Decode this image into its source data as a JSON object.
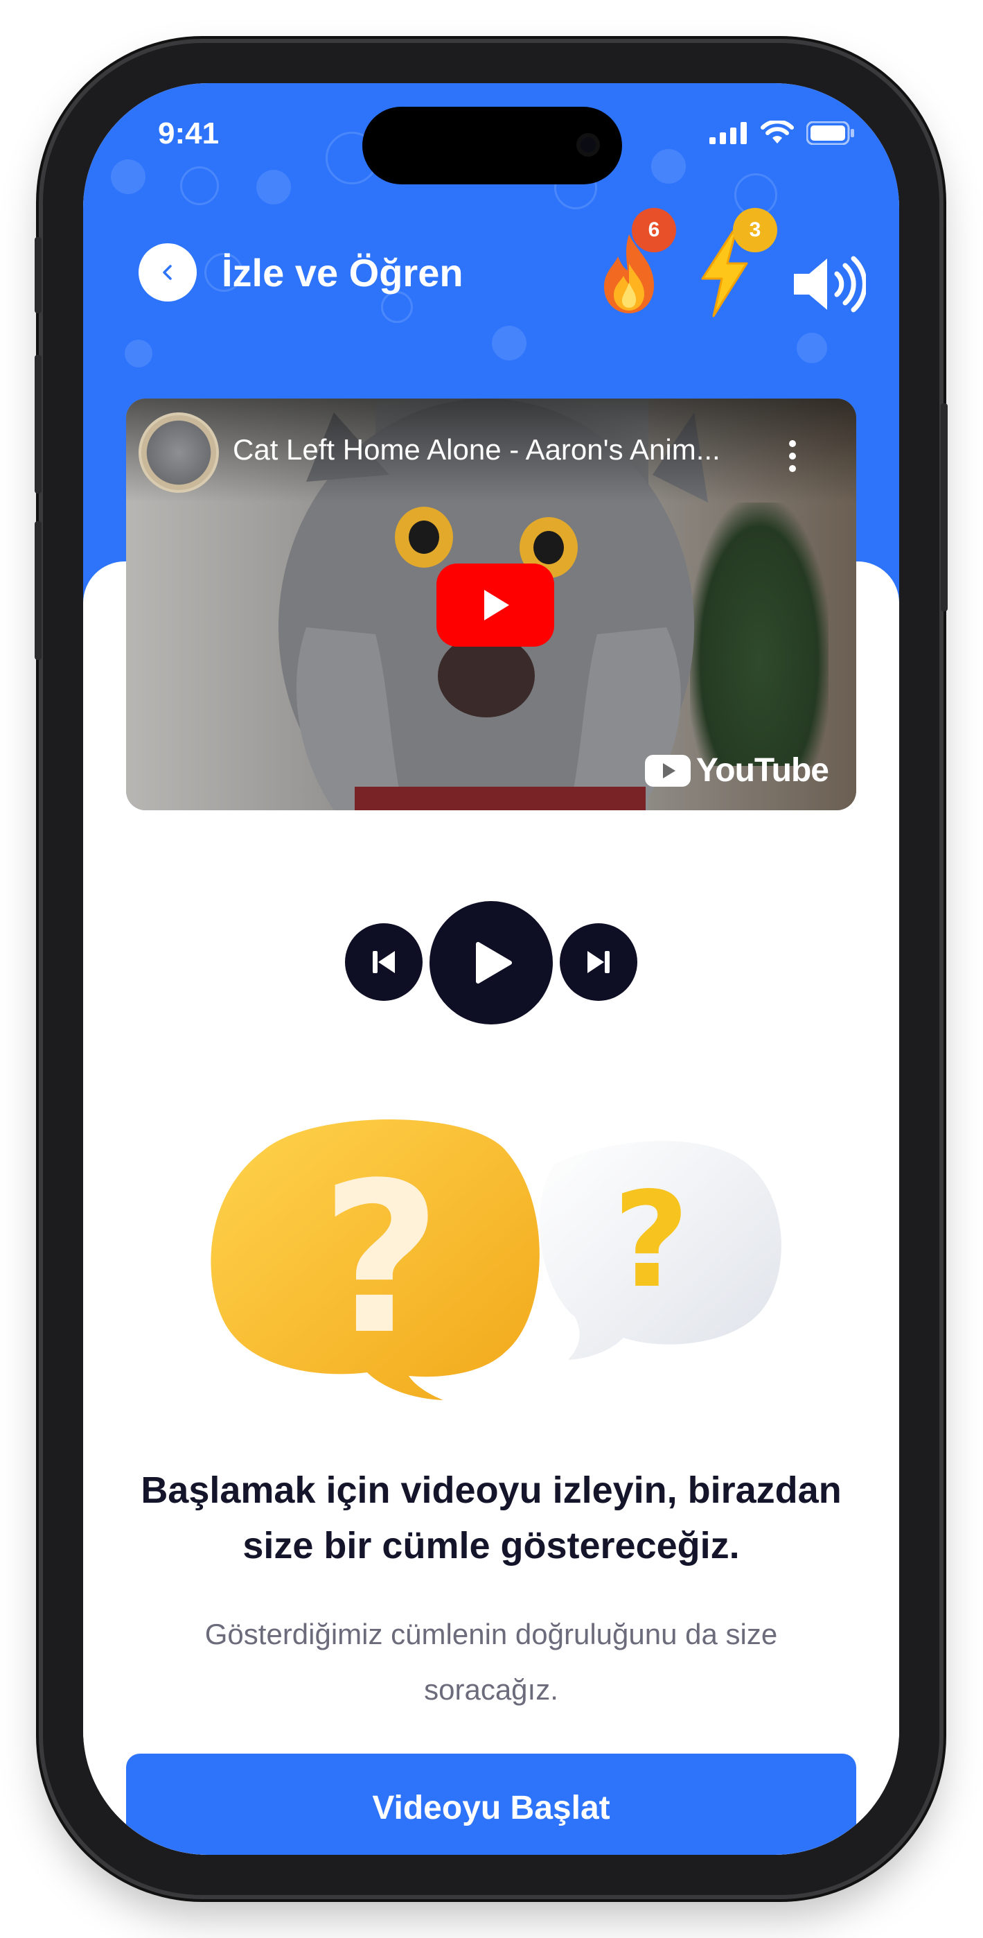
{
  "status_bar": {
    "time": "9:41"
  },
  "header": {
    "title": "İzle ve Öğren",
    "streak_count": "6",
    "energy_count": "3"
  },
  "video": {
    "title": "Cat Left Home Alone - Aaron's Anim...",
    "brand": "YouTube"
  },
  "content": {
    "heading": "Başlamak için videoyu izleyin, birazdan size bir cümle göstereceğiz.",
    "subtext": "Gösterdiğimiz cümlenin doğruluğunu da size soracağız."
  },
  "cta": {
    "label": "Videoyu Başlat"
  },
  "colors": {
    "primary": "#2d74fb",
    "dark": "#0e0e24",
    "streak_badge": "#e8502a",
    "energy_badge": "#f2b51c",
    "youtube_red": "#ff0000"
  },
  "icons": [
    "chevron-left-icon",
    "fire-icon",
    "lightning-icon",
    "speaker-icon",
    "more-vertical-icon",
    "play-icon",
    "skip-previous-icon",
    "skip-next-icon",
    "question-bubble-icon"
  ]
}
